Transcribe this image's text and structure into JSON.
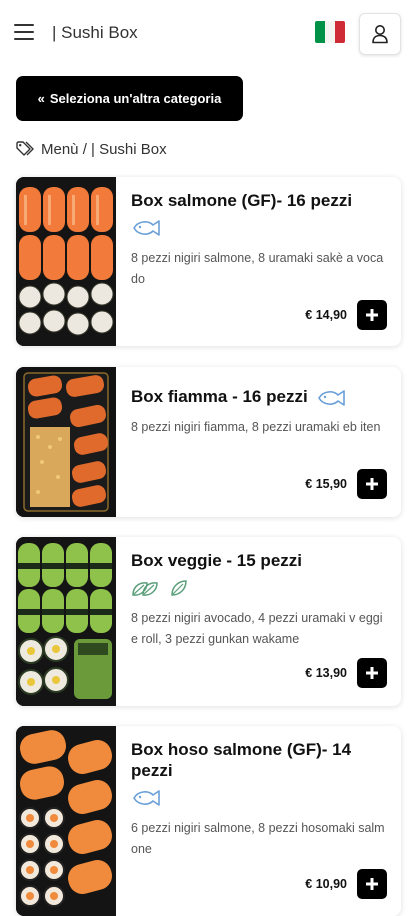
{
  "header": {
    "title": "| Sushi Box",
    "language_flag": "it-flag-icon",
    "user_icon": "user-icon"
  },
  "category_button": {
    "label": "Seleziona un'altra categoria"
  },
  "breadcrumb": {
    "text": "Menù / | Sushi Box"
  },
  "products": [
    {
      "name": "Box salmone (GF)- 16 pezzi",
      "tags": [
        "fish-icon"
      ],
      "description": "8 pezzi nigiri salmone, 8 uramaki sakè a vocado",
      "price": "€ 14,90"
    },
    {
      "name": "Box fiamma - 16 pezzi",
      "tags": [
        "fish-icon"
      ],
      "description": "8 pezzi nigiri fiamma, 8 pezzi uramaki eb iten",
      "price": "€ 15,90"
    },
    {
      "name": "Box veggie - 15 pezzi",
      "tags": [
        "vegetarian-leaf-icon",
        "vegan-leaf-icon"
      ],
      "description": "8 pezzi nigiri avocado, 4 pezzi uramaki v eggie roll, 3 pezzi gunkan wakame",
      "price": "€ 13,90"
    },
    {
      "name": "Box hoso salmone (GF)- 14 pezzi",
      "tags": [
        "fish-icon"
      ],
      "description": "6 pezzi nigiri salmone, 8 pezzi hosomaki salmone",
      "price": "€ 10,90"
    }
  ],
  "colors": {
    "accent": "#000000",
    "tag_icon": "#6a9fd8",
    "leaf_icon": "#5a9e7a"
  }
}
